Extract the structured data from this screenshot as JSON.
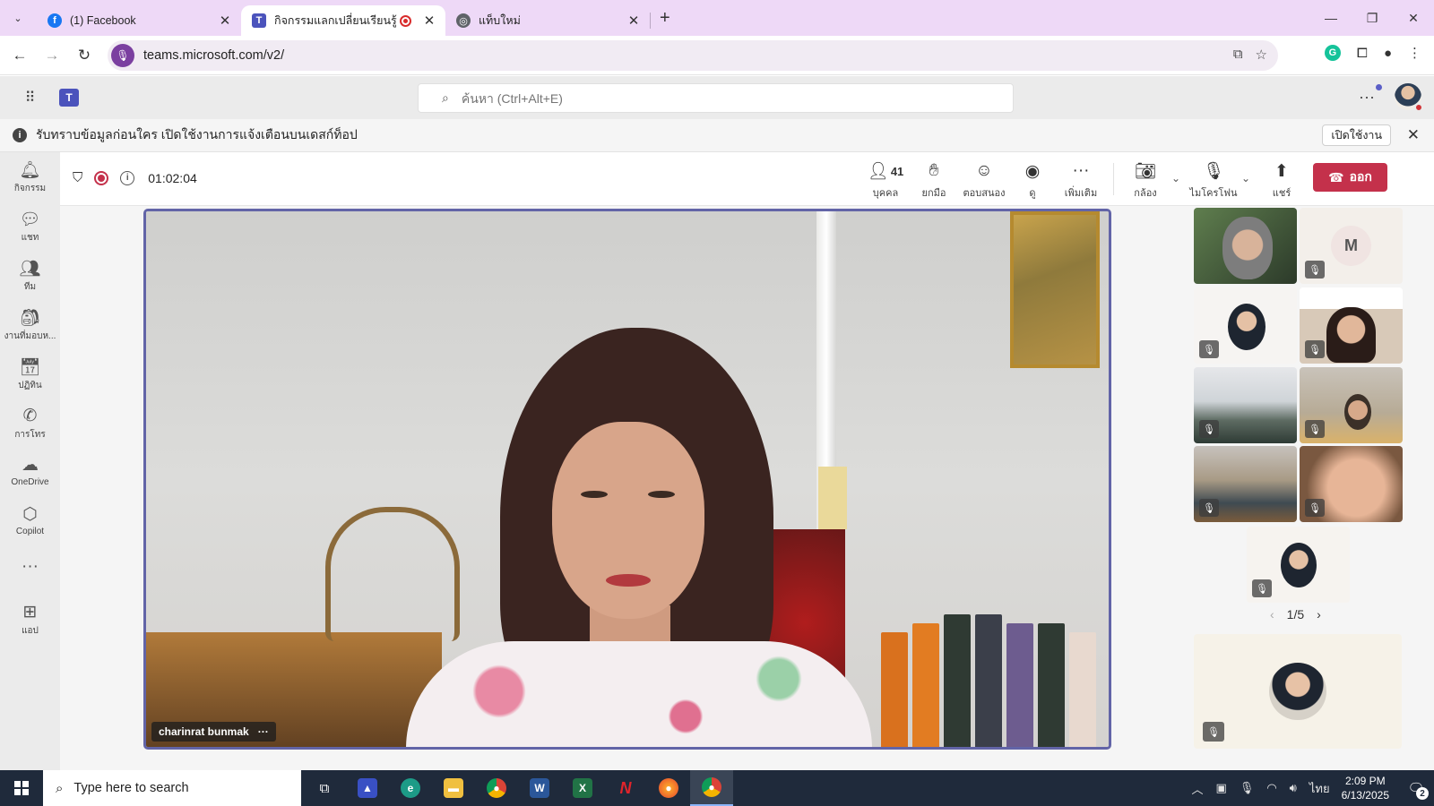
{
  "browser": {
    "tabs": [
      {
        "title": "(1) Facebook",
        "favicon_color": "#1877f2",
        "favicon": "f"
      },
      {
        "title": "กิจกรรมแลกเปลี่ยนเรียนรู้ SAR - ",
        "favicon_color": "#4b53bc",
        "favicon": "T",
        "recording": true
      },
      {
        "title": "แท็บใหม่",
        "favicon_color": "#5f6368",
        "favicon": "◎"
      }
    ],
    "url": "teams.microsoft.com/v2/"
  },
  "teams": {
    "search_placeholder": "ค้นหา (Ctrl+Alt+E)",
    "notice": {
      "message": "รับทราบข้อมูลก่อนใคร เปิดใช้งานการแจ้งเตือนบนเดสก์ท็อป",
      "enable_label": "เปิดใช้งาน"
    },
    "rail": [
      {
        "label": "กิจกรรม",
        "icon": "bell-icon",
        "glyph": "🔔︎"
      },
      {
        "label": "แชท",
        "icon": "chat-icon",
        "glyph": "💬︎"
      },
      {
        "label": "ทีม",
        "icon": "teams-icon",
        "glyph": "👥︎"
      },
      {
        "label": "งานที่มอบห...",
        "icon": "assignments-icon",
        "glyph": "🎒︎"
      },
      {
        "label": "ปฏิทิน",
        "icon": "calendar-icon",
        "glyph": "📅︎"
      },
      {
        "label": "การโทร",
        "icon": "phone-icon",
        "glyph": "✆"
      },
      {
        "label": "OneDrive",
        "icon": "cloud-icon",
        "glyph": "☁"
      },
      {
        "label": "Copilot",
        "icon": "copilot-icon",
        "glyph": "⬡"
      },
      {
        "label": "",
        "icon": "more-icon",
        "glyph": "···"
      },
      {
        "label": "แอป",
        "icon": "add-apps-icon",
        "glyph": "⊞"
      }
    ]
  },
  "meeting": {
    "timer": "01:02:04",
    "participants_count": "41",
    "controls": {
      "people": "บุคคล",
      "raise_hand": "ยกมือ",
      "react": "ตอบสนอง",
      "view": "ดู",
      "more": "เพิ่มเติม",
      "camera": "กล้อง",
      "mic": "ไมโครโฟน",
      "share": "แชร์",
      "leave": "ออก"
    },
    "speaker_name": "charinrat bunmak",
    "gallery_initial": "M",
    "pager": "1/5"
  },
  "taskbar": {
    "search_placeholder": "Type here to search",
    "lang": "ไทย",
    "time": "2:09 PM",
    "date": "6/13/2025",
    "notification_count": "2"
  }
}
